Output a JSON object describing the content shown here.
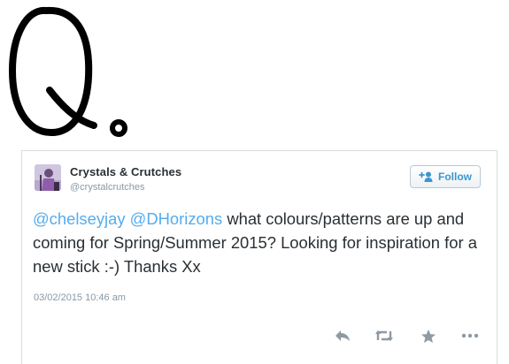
{
  "tweet": {
    "author_name": "Crystals & Crutches",
    "author_handle": "@crystalcrutches",
    "follow_label": "Follow",
    "mention_1": "@chelseyjay",
    "mention_2": "@DHorizons",
    "text": " what colours/patterns are up and coming for Spring/Summer 2015? Looking for inspiration for a new stick :-) Thanks Xx",
    "timestamp": "03/02/2015 10:46 am"
  },
  "actions": [
    {
      "icon": "reply-icon"
    },
    {
      "icon": "retweet-icon"
    },
    {
      "icon": "favorite-star-icon"
    },
    {
      "icon": "more-options-icon"
    }
  ],
  "handwriting": {
    "letters": "Q."
  },
  "colors": {
    "link": "#55acee",
    "text": "#292f33",
    "meta": "#8899a6",
    "action_icons": "#8f9aa3",
    "follow_text": "#3d95cf",
    "card_border": "#d8dde1"
  }
}
